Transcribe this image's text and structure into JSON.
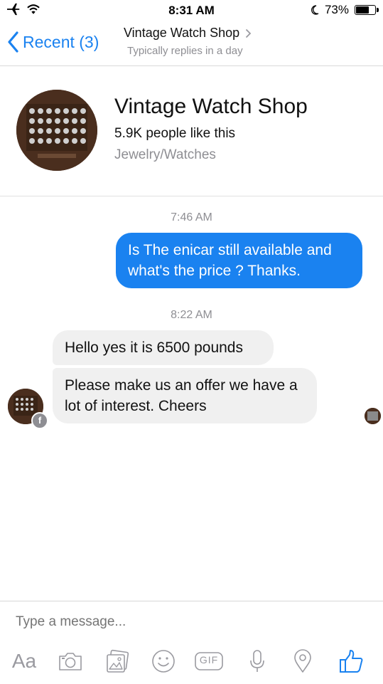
{
  "status_bar": {
    "time": "8:31 AM",
    "battery_percent": "73%",
    "battery_level": 0.73
  },
  "nav": {
    "back_label": "Recent (3)",
    "title": "Vintage Watch Shop",
    "subtitle": "Typically replies in a day"
  },
  "profile": {
    "name": "Vintage Watch Shop",
    "likes": "5.9K people like this",
    "category": "Jewelry/Watches"
  },
  "conversation": {
    "stamp_1": "7:46 AM",
    "sent_message": "Is The enicar still available and what's the price ?  Thanks.",
    "stamp_2": "8:22 AM",
    "received_1": "Hello yes it is 6500 pounds",
    "received_2": "Please make us an offer we have a lot of interest. Cheers"
  },
  "composer": {
    "placeholder": "Type a message...",
    "aa_label": "Aa",
    "gif_label": "GIF"
  },
  "colors": {
    "accent": "#1a82f0",
    "incoming_bubble": "#f0f0f0",
    "muted_text": "#8e8e93"
  }
}
